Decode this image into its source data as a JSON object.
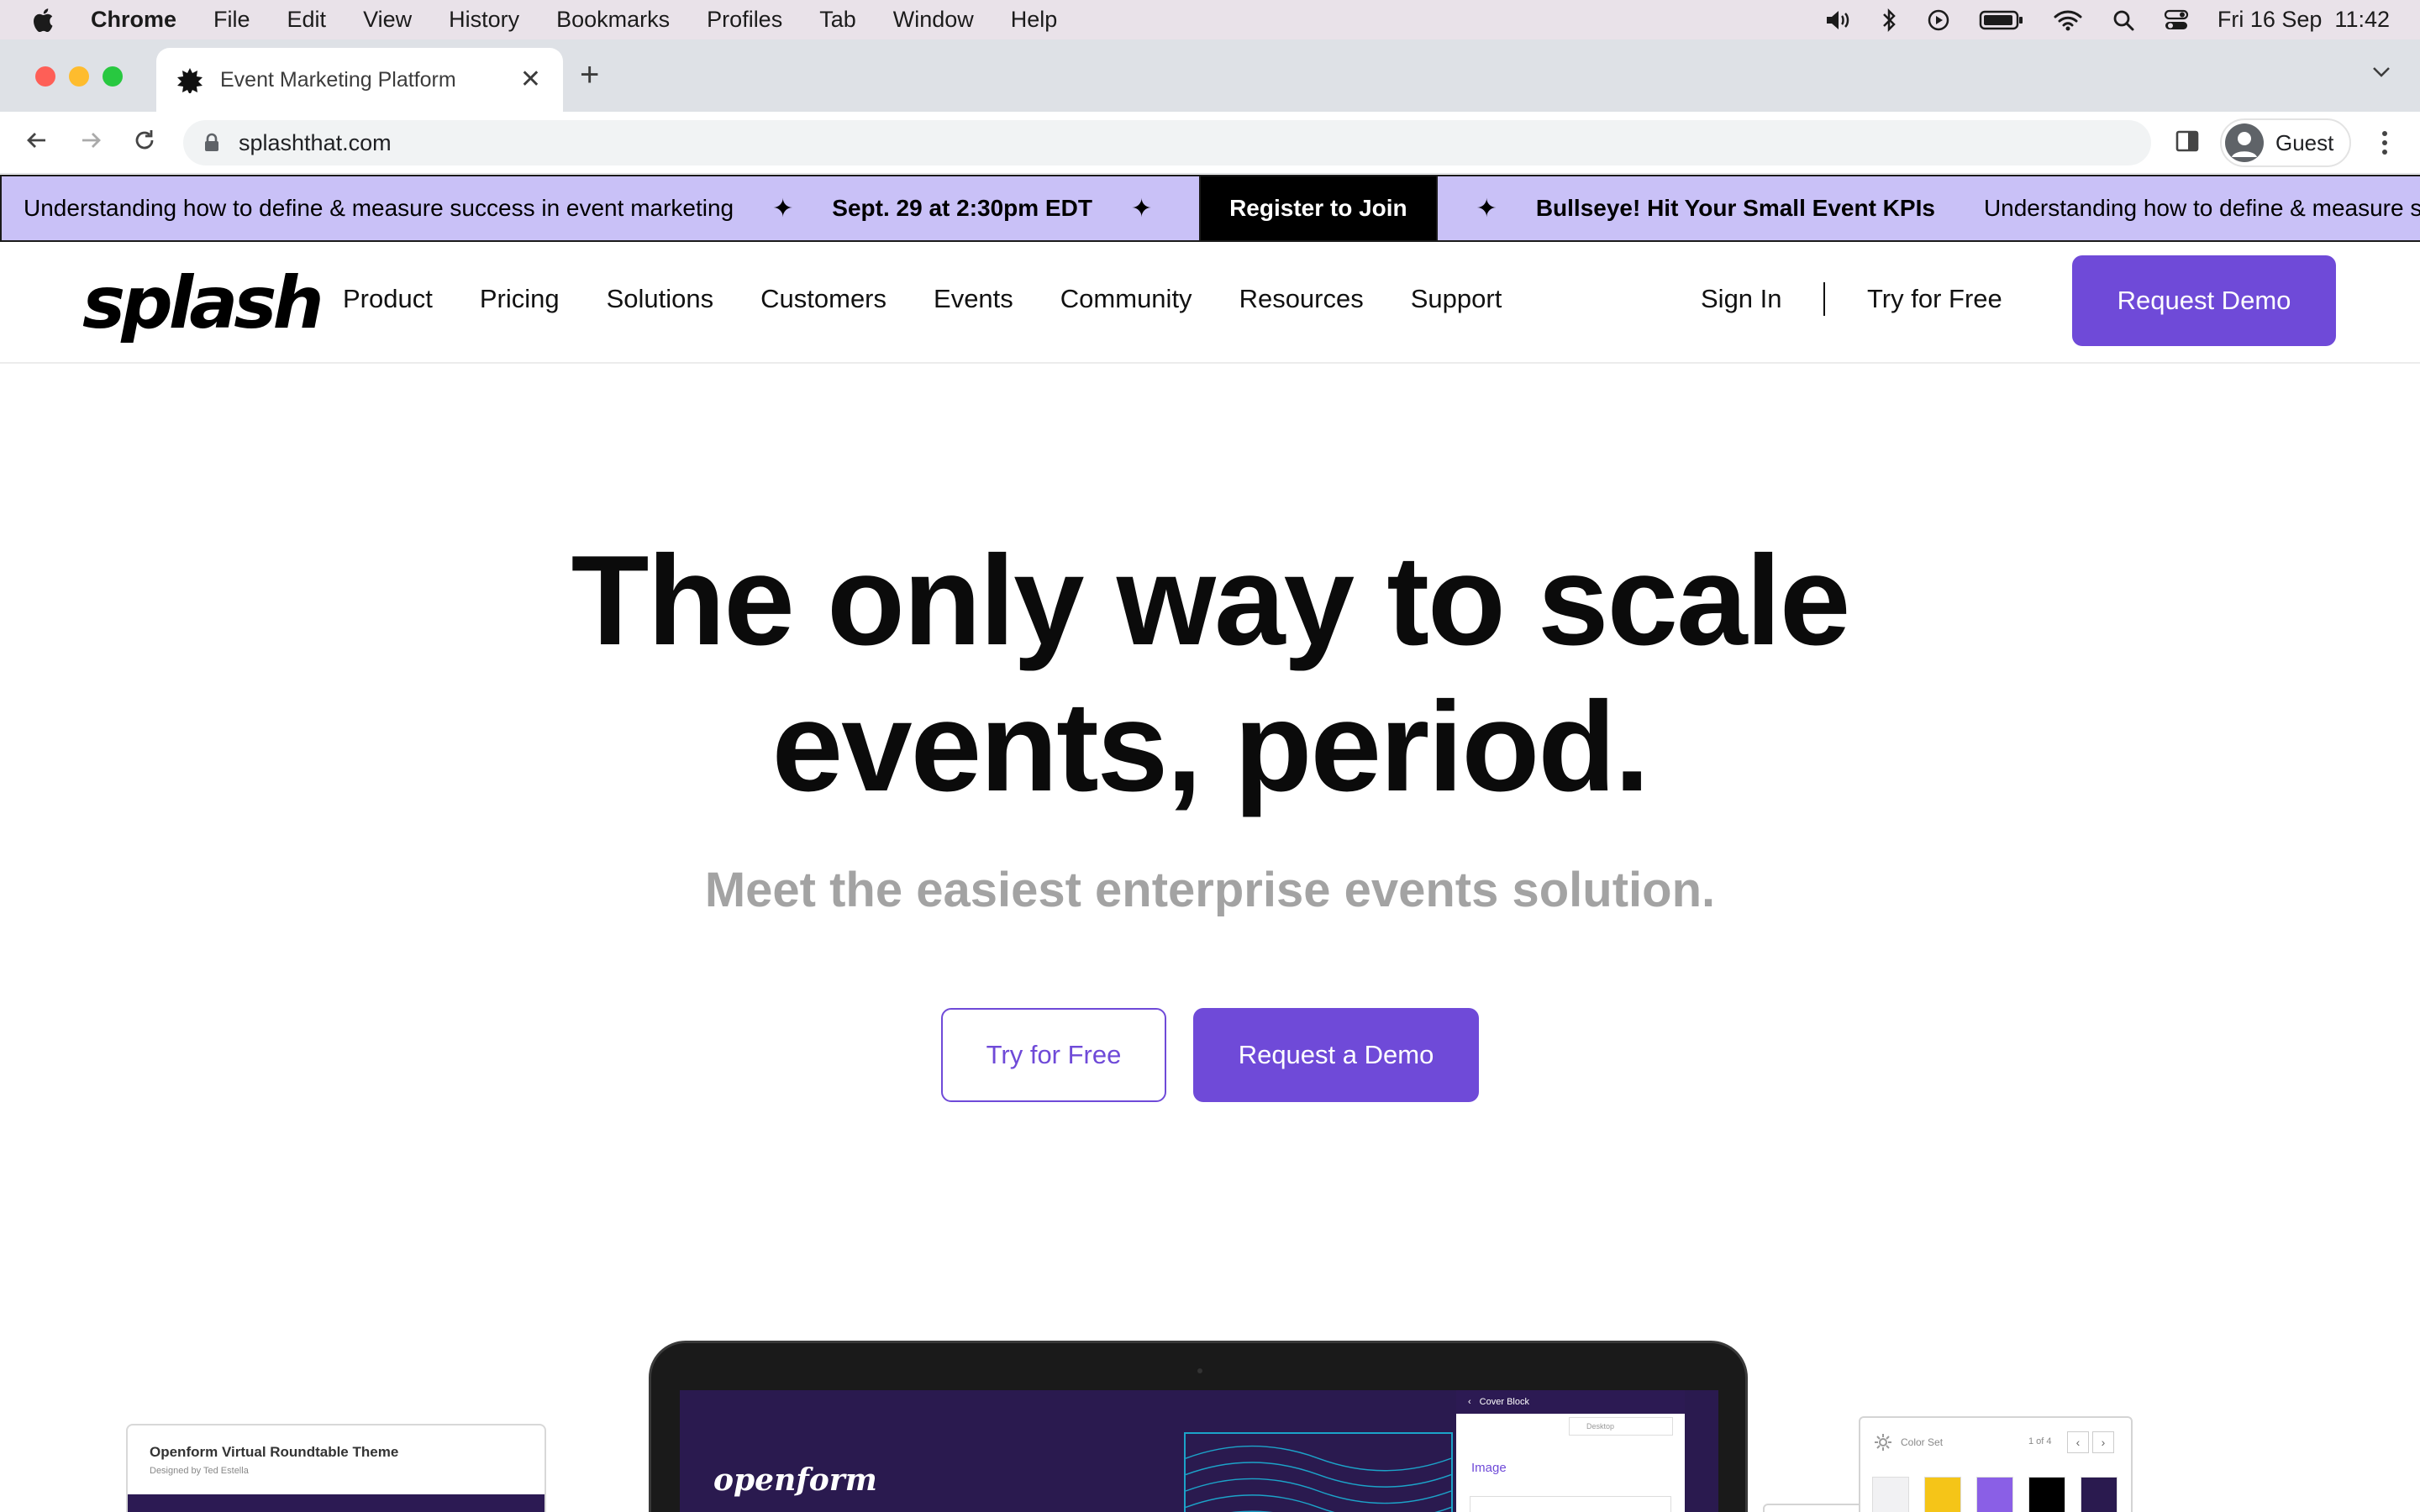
{
  "menubar": {
    "app": "Chrome",
    "items": [
      "File",
      "Edit",
      "View",
      "History",
      "Bookmarks",
      "Profiles",
      "Tab",
      "Window",
      "Help"
    ],
    "datetime": "Fri 16 Sep  11:42"
  },
  "browser": {
    "tab_title": "Event Marketing Platform",
    "url": "splashthat.com",
    "profile_label": "Guest"
  },
  "banner": {
    "text": "Understanding how to define & measure success in event marketing",
    "date": "Sept. 29 at 2:30pm EDT",
    "cta": "Register to Join",
    "promo": "Bullseye! Hit Your Small Event KPIs",
    "text_repeat": "Understanding how to define & measure success in event marketing",
    "star": "✦"
  },
  "header": {
    "logo": "splash",
    "nav": [
      "Product",
      "Pricing",
      "Solutions",
      "Customers",
      "Events",
      "Community",
      "Resources",
      "Support"
    ],
    "sign_in": "Sign In",
    "try_free": "Try for Free",
    "request_demo": "Request Demo"
  },
  "hero": {
    "title_line1": "The only way to scale",
    "title_line2": "events, period.",
    "subtitle": "Meet the easiest enterprise events solution.",
    "try_free": "Try for Free",
    "request_demo": "Request a Demo"
  },
  "showcase": {
    "left_card_title": "Openform Virtual Roundtable Theme",
    "left_card_subtitle": "Designed by Ted Estella",
    "screen_brand": "openform",
    "panel_header": "Cover Block",
    "panel_dropdown": "Desktop",
    "panel_image_label": "Image",
    "color_set_label": "Color Set",
    "color_set_page": "1 of 4",
    "swatches": [
      "#f1f1f3",
      "#f5c518",
      "#8a5fe6",
      "#000000",
      "#2a1a4f"
    ]
  },
  "colors": {
    "accent": "#6f4ad8",
    "banner_bg": "#c9c1f7"
  }
}
